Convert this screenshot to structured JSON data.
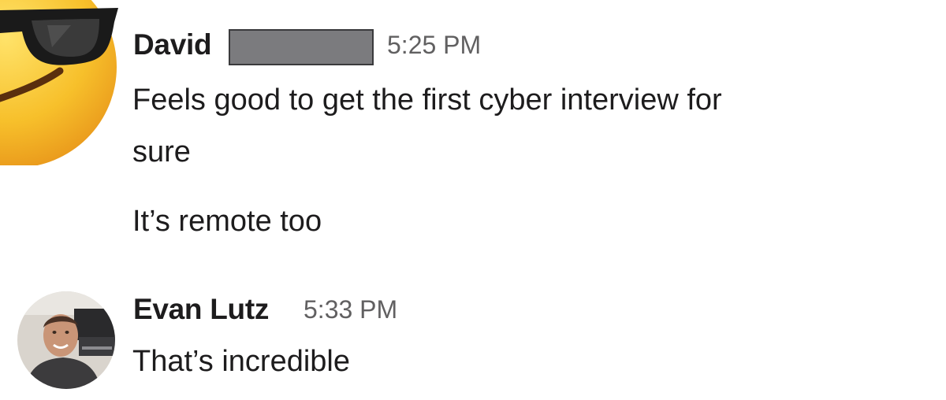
{
  "messages": [
    {
      "sender": "David",
      "time": "5:25 PM",
      "avatar": "sunglasses-emoji",
      "lines": [
        "Feels good to get the first cyber interview for",
        "sure",
        "It’s remote too"
      ]
    },
    {
      "sender": "Evan Lutz",
      "time": "5:33 PM",
      "avatar": "profile-photo",
      "lines": [
        "That’s incredible"
      ]
    }
  ],
  "colors": {
    "text": "#1d1c1d",
    "timestamp": "#616061",
    "redaction": "#7b7b7e",
    "emoji_face": "#f7c02b"
  }
}
